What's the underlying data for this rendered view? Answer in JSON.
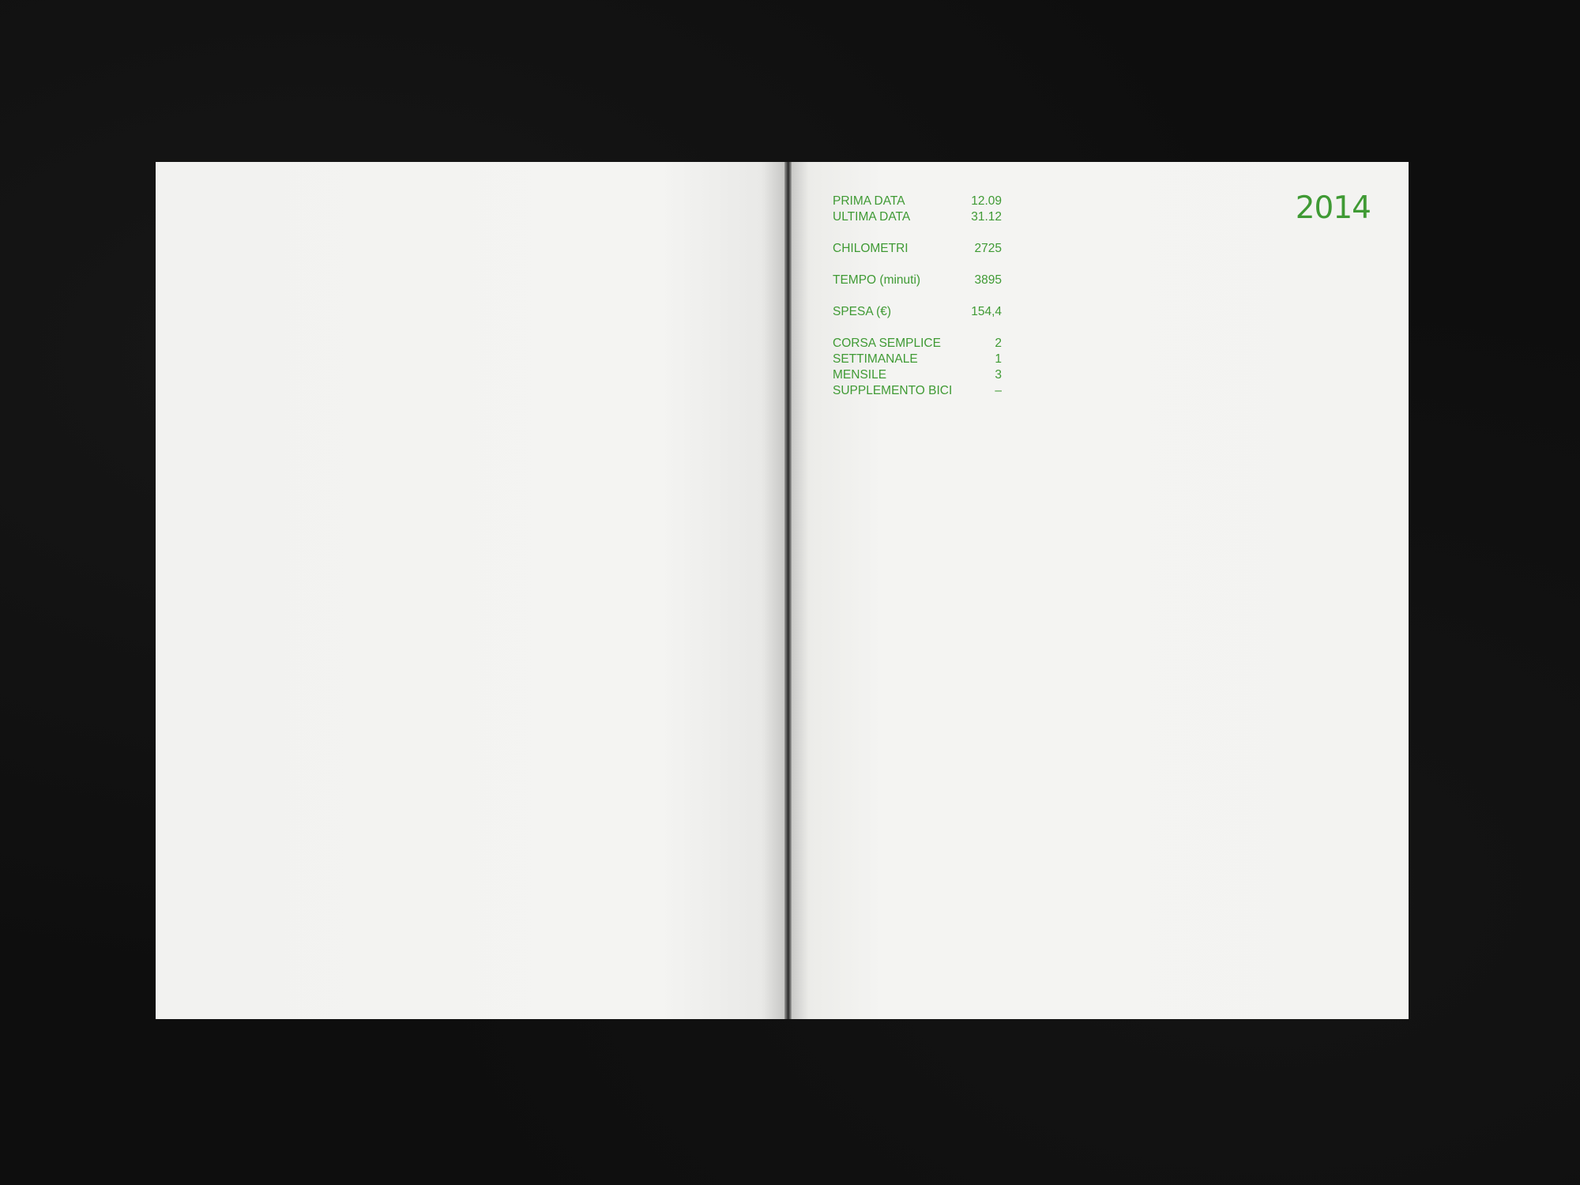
{
  "year": "2014",
  "stats": {
    "groups": [
      {
        "rows": [
          {
            "label": "PRIMA DATA",
            "value": "12.09"
          },
          {
            "label": "ULTIMA DATA",
            "value": "31.12"
          }
        ]
      },
      {
        "rows": [
          {
            "label": "CHILOMETRI",
            "value": "2725"
          }
        ]
      },
      {
        "rows": [
          {
            "label": "TEMPO (minuti)",
            "value": "3895"
          }
        ]
      },
      {
        "rows": [
          {
            "label": "SPESA (€)",
            "value": "154,4"
          }
        ]
      },
      {
        "rows": [
          {
            "label": "CORSA SEMPLICE",
            "value": "2"
          },
          {
            "label": "SETTIMANALE",
            "value": "1"
          },
          {
            "label": "MENSILE",
            "value": "3"
          },
          {
            "label": "SUPPLEMENTO BICI",
            "value": "–"
          }
        ]
      }
    ]
  },
  "colors": {
    "ink_green": "#3f9a34",
    "paper": "#f3f3f1",
    "background": "#0e0e0e"
  }
}
